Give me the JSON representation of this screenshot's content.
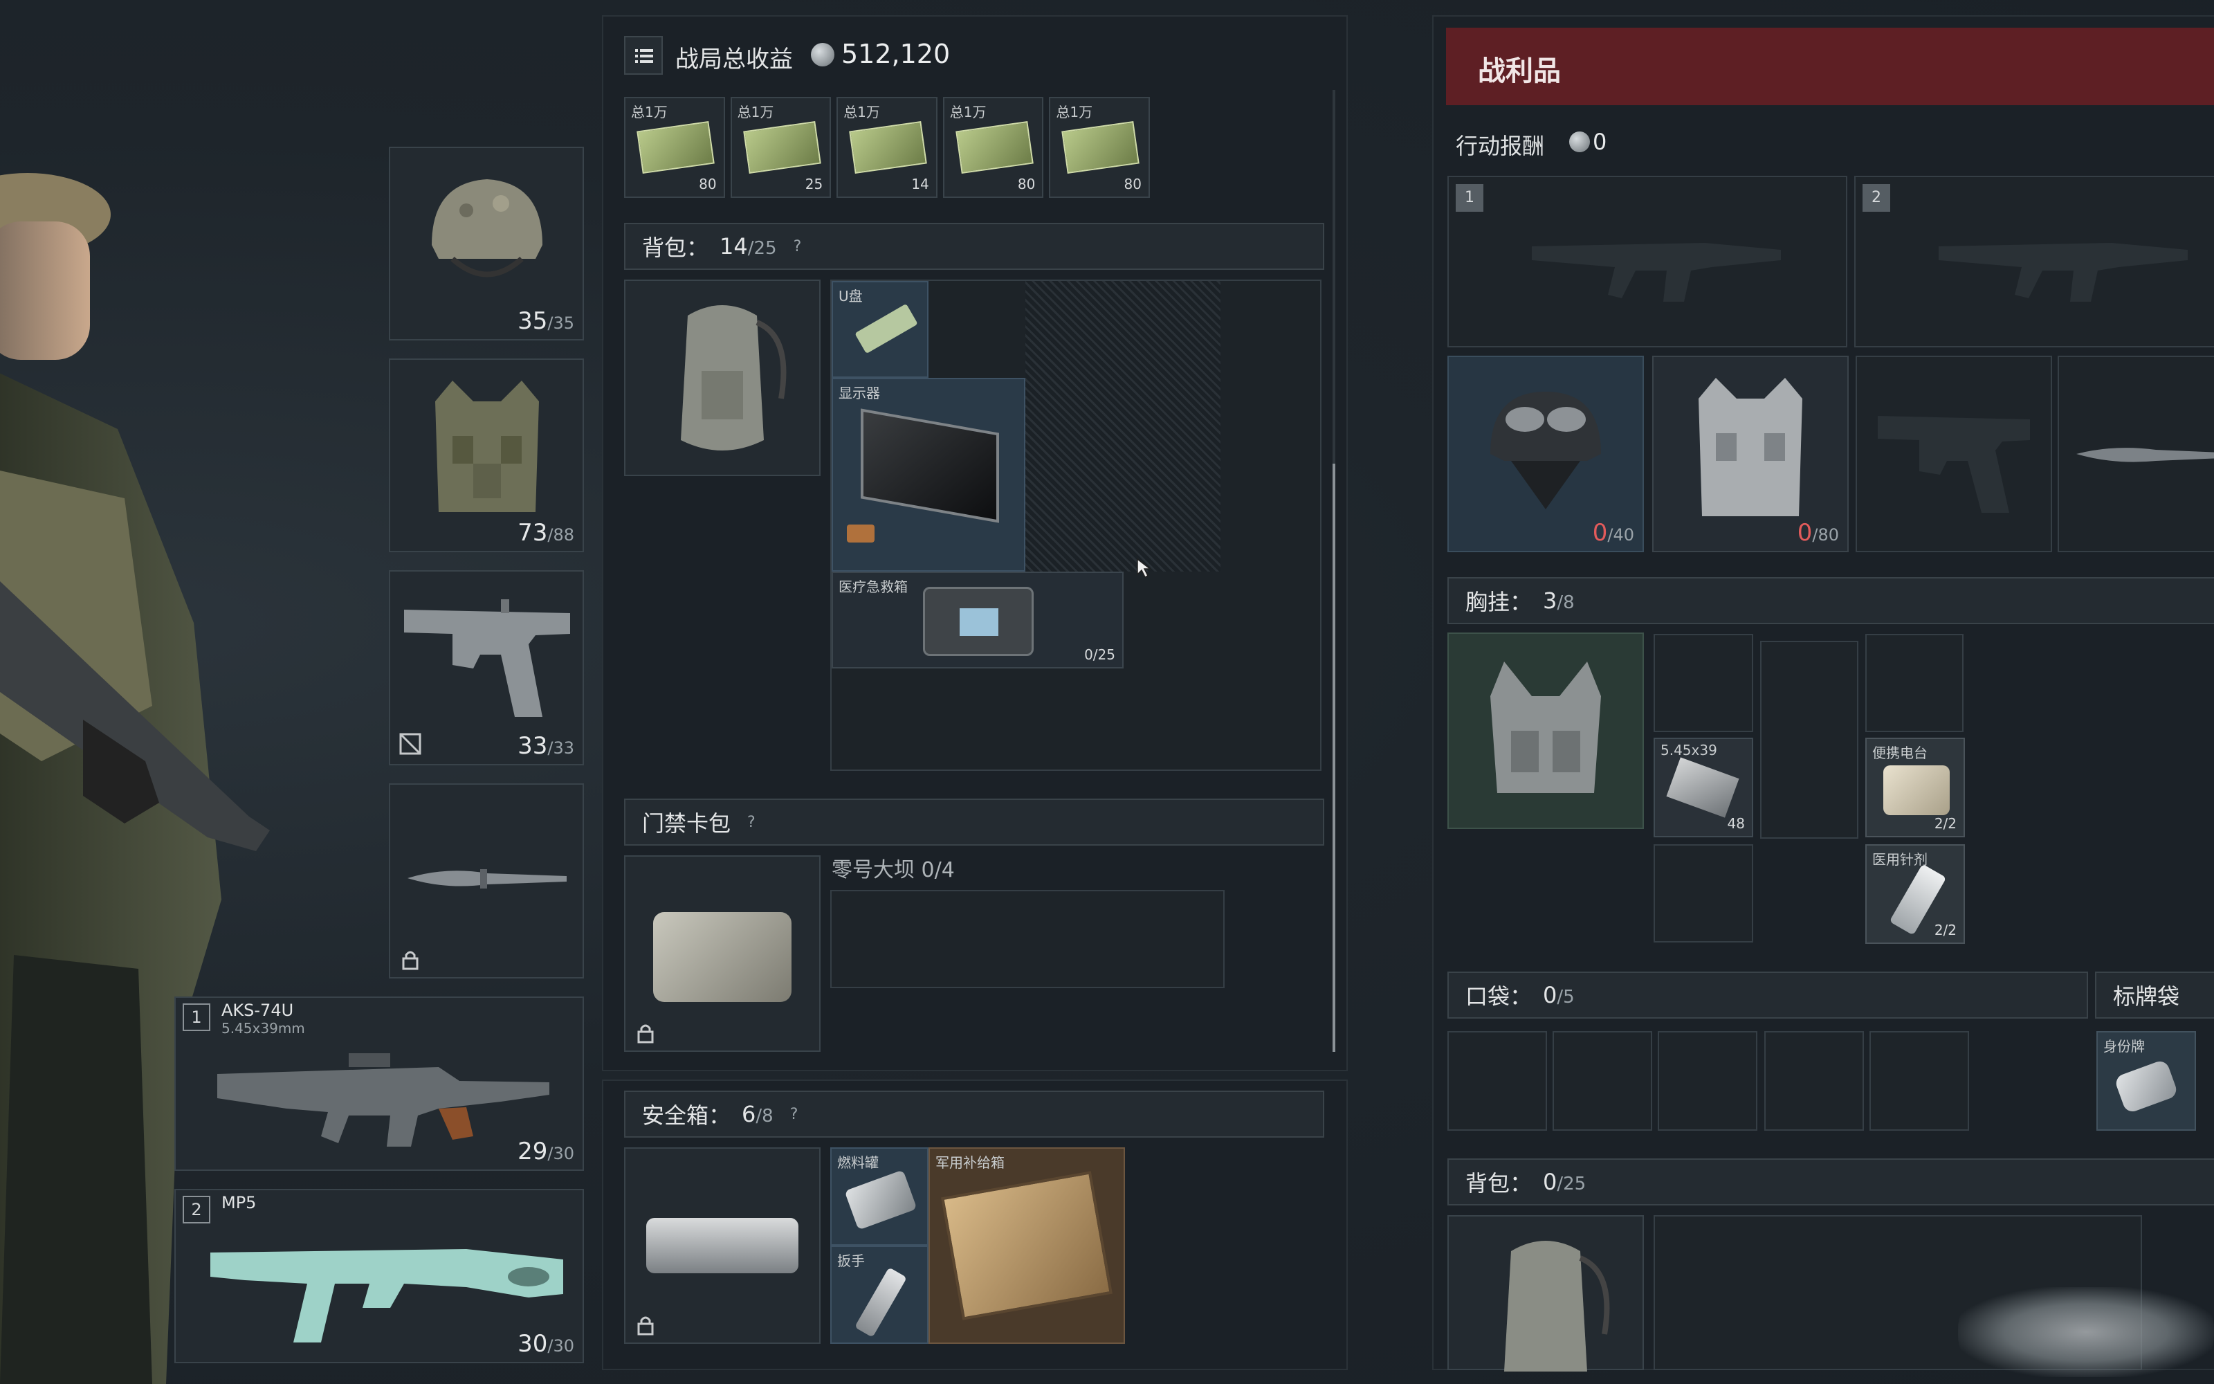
{
  "header": {
    "title": "战局总收益",
    "total": "512,120"
  },
  "money_cards": [
    {
      "tag": "总1万",
      "count": "80"
    },
    {
      "tag": "总1万",
      "count": "25"
    },
    {
      "tag": "总1万",
      "count": "14"
    },
    {
      "tag": "总1万",
      "count": "80"
    },
    {
      "tag": "总1万",
      "count": "80"
    }
  ],
  "equipment": {
    "helmet": {
      "cur": "35",
      "max": "/35"
    },
    "armor": {
      "cur": "73",
      "max": "/88"
    },
    "pistol": {
      "cur": "33",
      "max": "/33"
    },
    "weapon1": {
      "index": "1",
      "name": "AKS-74U",
      "caliber": "5.45x39mm",
      "cur": "29",
      "max": "/30"
    },
    "weapon2": {
      "index": "2",
      "name": "MP5",
      "cur": "30",
      "max": "/30"
    }
  },
  "backpack": {
    "label": "背包：",
    "cur": "14",
    "max": "/25",
    "help": "?",
    "items": [
      {
        "tag": "U盘"
      },
      {
        "tag": "显示器"
      },
      {
        "tag": "医疗急救箱",
        "count": "0/25"
      }
    ]
  },
  "keycard": {
    "label": "门禁卡包",
    "help": "?",
    "slot_text": "零号大坝 0/4"
  },
  "safebox": {
    "label": "安全箱：",
    "cur": "6",
    "max": "/8",
    "help": "?",
    "items": [
      {
        "tag": "燃料罐"
      },
      {
        "tag": "扳手"
      },
      {
        "tag": "军用补给箱"
      }
    ]
  },
  "loot": {
    "title": "战利品",
    "reward_label": "行动报酬",
    "reward_value": "0",
    "weapon_slots": [
      "1",
      "2"
    ],
    "helmet": {
      "cur": "0",
      "max": "/40"
    },
    "armor": {
      "cur": "0",
      "max": "/80"
    },
    "chest": {
      "label": "胸挂：",
      "cur": "3",
      "max": "/8",
      "items": [
        {
          "tag": "5.45x39",
          "count": "48"
        },
        {
          "tag": "便携电台",
          "count": "2/2"
        },
        {
          "tag": "医用针剂",
          "count": "2/2"
        }
      ]
    },
    "pockets": {
      "label": "口袋：",
      "cur": "0",
      "max": "/5"
    },
    "tagbag": {
      "label": "标牌袋",
      "item_tag": "身份牌"
    },
    "backpack": {
      "label": "背包：",
      "cur": "0",
      "max": "/25"
    }
  },
  "colors": {
    "accent_red": "#5e1f24",
    "bg": "#1f262c",
    "slot_border": "#39434a"
  }
}
